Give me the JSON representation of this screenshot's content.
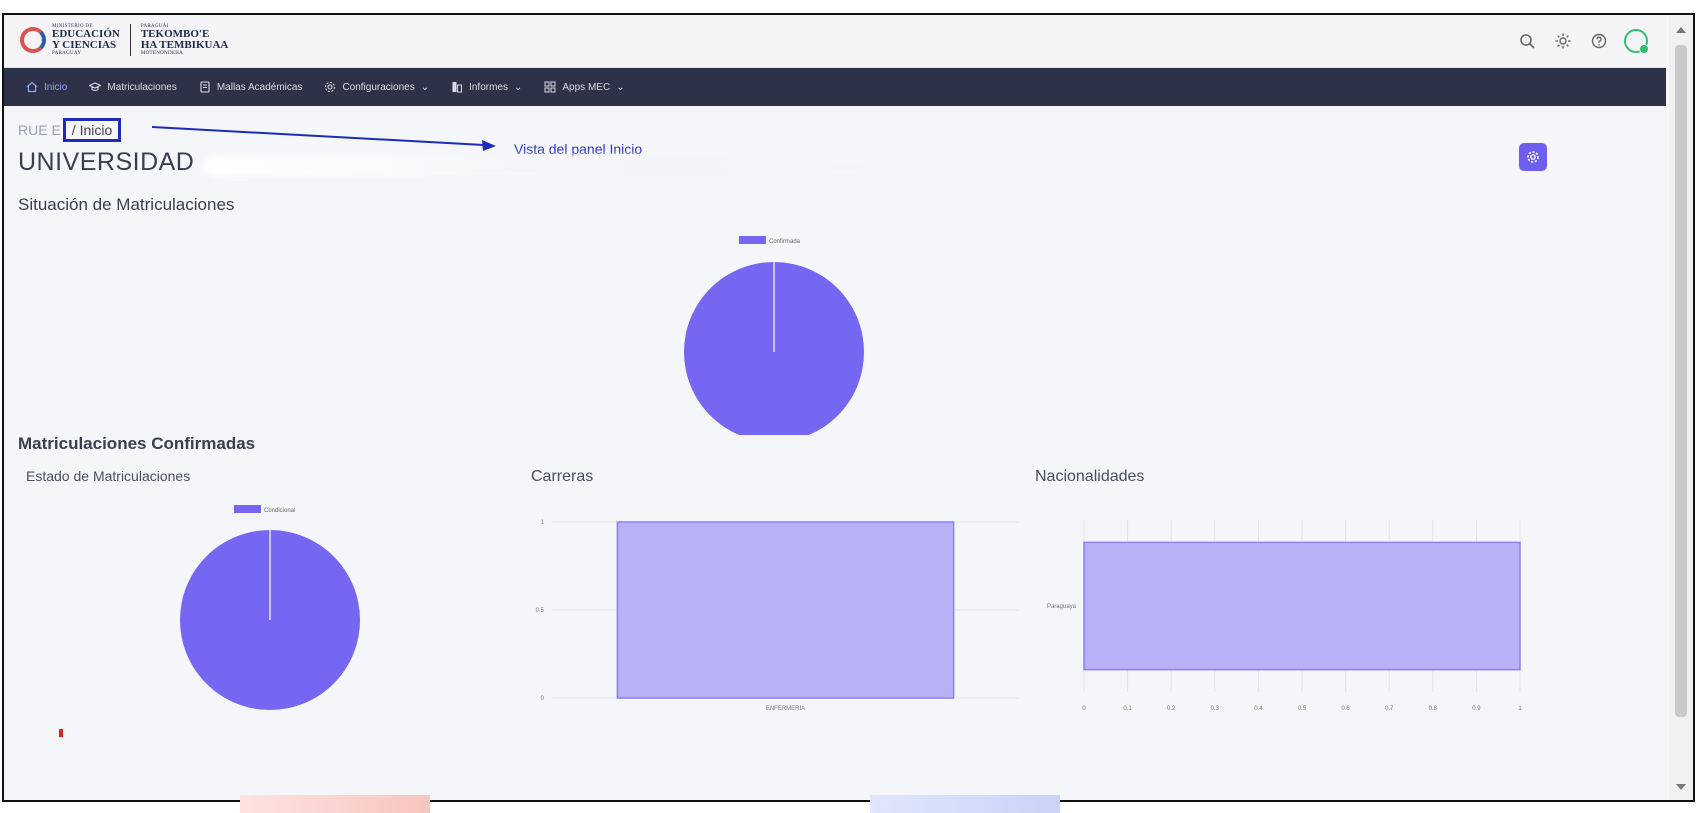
{
  "header": {
    "logo_lines_left": [
      "MINISTERIO DE",
      "EDUCACIÓN",
      "Y CIENCIAS",
      "PARAGUAY"
    ],
    "logo_lines_right": [
      "PARAGUÁI",
      "TEKOMBO'E",
      "HA TEMBIKUAA",
      "MOTENONDEHA"
    ],
    "icons": [
      "search-icon",
      "sun-icon",
      "help-icon",
      "user-avatar-icon"
    ]
  },
  "nav": {
    "items": [
      {
        "label": "Inicio",
        "icon": "home-icon",
        "active": true
      },
      {
        "label": "Matriculaciones",
        "icon": "graduation-cap-icon"
      },
      {
        "label": "Mallas Académicas",
        "icon": "document-icon"
      },
      {
        "label": "Configuraciones",
        "icon": "gear-icon",
        "dropdown": true
      },
      {
        "label": "Informes",
        "icon": "report-icon",
        "dropdown": true
      },
      {
        "label": "Apps MEC",
        "icon": "apps-icon",
        "dropdown": true
      }
    ]
  },
  "breadcrumb": {
    "root": "RUE E",
    "current": "/ Inicio"
  },
  "annotation": {
    "text": "Vista del panel Inicio"
  },
  "page": {
    "title": "UNIVERSIDAD"
  },
  "sections": {
    "situacion": "Situación de Matriculaciones",
    "confirmadas": "Matriculaciones Confirmadas",
    "estado": "Estado de Matriculaciones",
    "carreras": "Carreras",
    "nacionalidades": "Nacionalidades"
  },
  "colors": {
    "accent": "#7567f2",
    "bar_fill": "#b9b1f7",
    "bar_stroke": "#8c80f2",
    "navbar": "#2d3248"
  },
  "chart_data": [
    {
      "type": "pie",
      "title": "Situación de Matriculaciones",
      "legend": [
        "Confirmada"
      ],
      "legend_position": "top",
      "slices": [
        {
          "label": "Confirmada",
          "value": 1
        }
      ]
    },
    {
      "type": "pie",
      "title": "Estado de Matriculaciones",
      "legend": [
        "Condicional"
      ],
      "legend_position": "top",
      "slices": [
        {
          "label": "Condicional",
          "value": 1
        }
      ]
    },
    {
      "type": "bar",
      "title": "Carreras",
      "categories": [
        "ENFERMERIA"
      ],
      "values": [
        1
      ],
      "ylim": [
        0,
        1
      ],
      "yticks": [
        "1",
        "0.5",
        "0"
      ],
      "grid": true
    },
    {
      "type": "bar",
      "orientation": "horizontal",
      "title": "Nacionalidades",
      "categories": [
        "Paraguaya"
      ],
      "values": [
        1
      ],
      "xlim": [
        0,
        1
      ],
      "xticks": [
        "0",
        "0.1",
        "0.2",
        "0.3",
        "0.4",
        "0.5",
        "0.6",
        "0.7",
        "0.8",
        "0.9",
        "1"
      ],
      "grid": true
    }
  ]
}
